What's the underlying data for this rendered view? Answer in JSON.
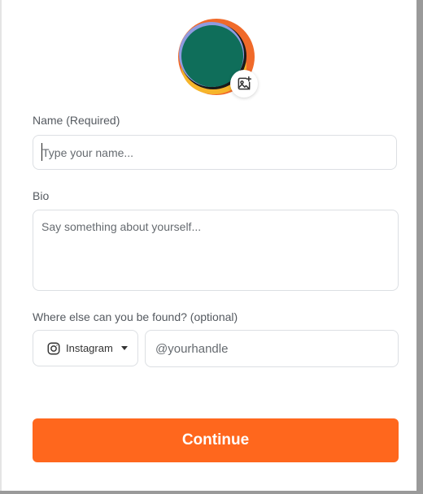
{
  "colors": {
    "accent": "#ff671d",
    "avatar_green": "#0f6e5a",
    "avatar_yellow": "#f6b52b",
    "avatar_orange": "#f06a2a",
    "avatar_lavender": "#8f9be0"
  },
  "avatar": {
    "upload_icon": "image-plus-icon"
  },
  "name": {
    "label": "Name (Required)",
    "placeholder": "Type your name...",
    "value": ""
  },
  "bio": {
    "label": "Bio",
    "placeholder": "Say something about yourself...",
    "value": ""
  },
  "social": {
    "label": "Where else can you be found? (optional)",
    "platform": "Instagram",
    "platform_icon": "instagram-icon",
    "handle_placeholder": "@yourhandle",
    "handle_value": ""
  },
  "continue_label": "Continue"
}
